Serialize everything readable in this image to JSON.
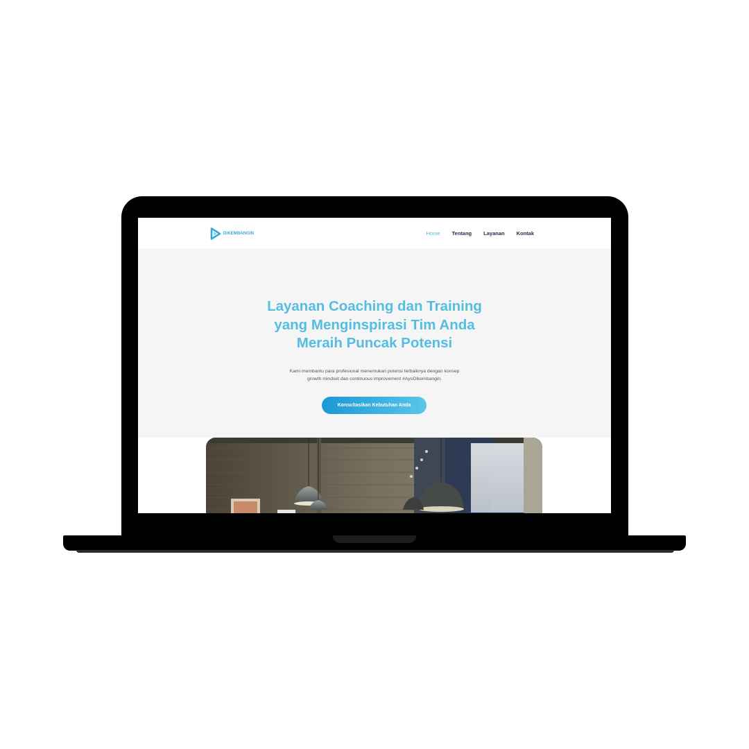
{
  "site": {
    "logo": {
      "icon": "play-triangle-logo-icon",
      "text": "DIKEMBANGIN",
      "color": "#3aa6d8"
    },
    "nav": {
      "items": [
        {
          "label": "Home",
          "active": true
        },
        {
          "label": "Tentang",
          "active": false
        },
        {
          "label": "Layanan",
          "active": false
        },
        {
          "label": "Kontak",
          "active": false
        }
      ],
      "active_color": "#4bb6de",
      "text_color": "#1d2c4d"
    },
    "hero": {
      "title_lines": [
        "Layanan Coaching dan Training",
        "yang Menginspirasi Tim Anda",
        "Meraih Puncak Potensi"
      ],
      "title_color": "#55bde0",
      "subtitle_lines": [
        "Kami membantu para profesional menemukan potensi terbaiknya dengan konsep",
        "growth mindset dan continuous improvement #AyoDikembangin."
      ],
      "cta_label": "Konsultasikan Kebutuhan Anda",
      "cta_gradient": [
        "#1b97d6",
        "#5ac6ea"
      ],
      "background": "#f5f5f5"
    },
    "photo": {
      "subject": "office-interior-with-pendant-lamps-image"
    }
  },
  "device": {
    "frame": "laptop",
    "frame_color": "#000000"
  }
}
